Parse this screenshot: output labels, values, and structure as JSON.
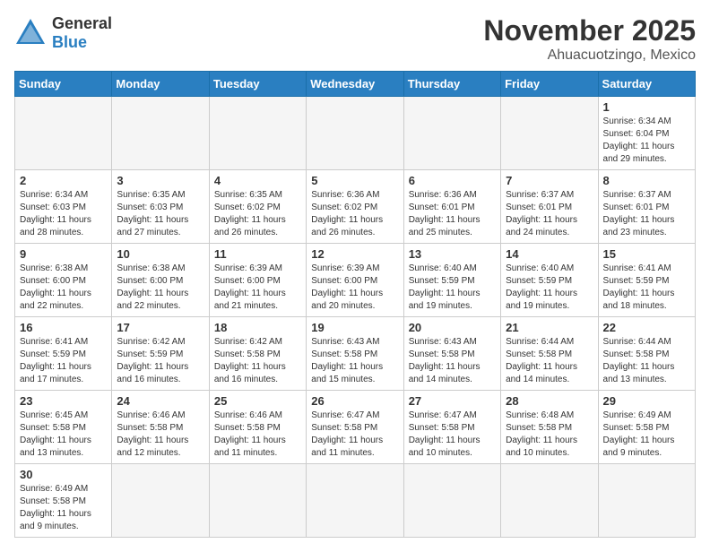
{
  "header": {
    "logo_general": "General",
    "logo_blue": "Blue",
    "month_year": "November 2025",
    "location": "Ahuacuotzingo, Mexico"
  },
  "days_of_week": [
    "Sunday",
    "Monday",
    "Tuesday",
    "Wednesday",
    "Thursday",
    "Friday",
    "Saturday"
  ],
  "weeks": [
    [
      {
        "day": "",
        "info": ""
      },
      {
        "day": "",
        "info": ""
      },
      {
        "day": "",
        "info": ""
      },
      {
        "day": "",
        "info": ""
      },
      {
        "day": "",
        "info": ""
      },
      {
        "day": "",
        "info": ""
      },
      {
        "day": "1",
        "info": "Sunrise: 6:34 AM\nSunset: 6:04 PM\nDaylight: 11 hours and 29 minutes."
      }
    ],
    [
      {
        "day": "2",
        "info": "Sunrise: 6:34 AM\nSunset: 6:03 PM\nDaylight: 11 hours and 28 minutes."
      },
      {
        "day": "3",
        "info": "Sunrise: 6:35 AM\nSunset: 6:03 PM\nDaylight: 11 hours and 27 minutes."
      },
      {
        "day": "4",
        "info": "Sunrise: 6:35 AM\nSunset: 6:02 PM\nDaylight: 11 hours and 26 minutes."
      },
      {
        "day": "5",
        "info": "Sunrise: 6:36 AM\nSunset: 6:02 PM\nDaylight: 11 hours and 26 minutes."
      },
      {
        "day": "6",
        "info": "Sunrise: 6:36 AM\nSunset: 6:01 PM\nDaylight: 11 hours and 25 minutes."
      },
      {
        "day": "7",
        "info": "Sunrise: 6:37 AM\nSunset: 6:01 PM\nDaylight: 11 hours and 24 minutes."
      },
      {
        "day": "8",
        "info": "Sunrise: 6:37 AM\nSunset: 6:01 PM\nDaylight: 11 hours and 23 minutes."
      }
    ],
    [
      {
        "day": "9",
        "info": "Sunrise: 6:38 AM\nSunset: 6:00 PM\nDaylight: 11 hours and 22 minutes."
      },
      {
        "day": "10",
        "info": "Sunrise: 6:38 AM\nSunset: 6:00 PM\nDaylight: 11 hours and 22 minutes."
      },
      {
        "day": "11",
        "info": "Sunrise: 6:39 AM\nSunset: 6:00 PM\nDaylight: 11 hours and 21 minutes."
      },
      {
        "day": "12",
        "info": "Sunrise: 6:39 AM\nSunset: 6:00 PM\nDaylight: 11 hours and 20 minutes."
      },
      {
        "day": "13",
        "info": "Sunrise: 6:40 AM\nSunset: 5:59 PM\nDaylight: 11 hours and 19 minutes."
      },
      {
        "day": "14",
        "info": "Sunrise: 6:40 AM\nSunset: 5:59 PM\nDaylight: 11 hours and 19 minutes."
      },
      {
        "day": "15",
        "info": "Sunrise: 6:41 AM\nSunset: 5:59 PM\nDaylight: 11 hours and 18 minutes."
      }
    ],
    [
      {
        "day": "16",
        "info": "Sunrise: 6:41 AM\nSunset: 5:59 PM\nDaylight: 11 hours and 17 minutes."
      },
      {
        "day": "17",
        "info": "Sunrise: 6:42 AM\nSunset: 5:59 PM\nDaylight: 11 hours and 16 minutes."
      },
      {
        "day": "18",
        "info": "Sunrise: 6:42 AM\nSunset: 5:58 PM\nDaylight: 11 hours and 16 minutes."
      },
      {
        "day": "19",
        "info": "Sunrise: 6:43 AM\nSunset: 5:58 PM\nDaylight: 11 hours and 15 minutes."
      },
      {
        "day": "20",
        "info": "Sunrise: 6:43 AM\nSunset: 5:58 PM\nDaylight: 11 hours and 14 minutes."
      },
      {
        "day": "21",
        "info": "Sunrise: 6:44 AM\nSunset: 5:58 PM\nDaylight: 11 hours and 14 minutes."
      },
      {
        "day": "22",
        "info": "Sunrise: 6:44 AM\nSunset: 5:58 PM\nDaylight: 11 hours and 13 minutes."
      }
    ],
    [
      {
        "day": "23",
        "info": "Sunrise: 6:45 AM\nSunset: 5:58 PM\nDaylight: 11 hours and 13 minutes."
      },
      {
        "day": "24",
        "info": "Sunrise: 6:46 AM\nSunset: 5:58 PM\nDaylight: 11 hours and 12 minutes."
      },
      {
        "day": "25",
        "info": "Sunrise: 6:46 AM\nSunset: 5:58 PM\nDaylight: 11 hours and 11 minutes."
      },
      {
        "day": "26",
        "info": "Sunrise: 6:47 AM\nSunset: 5:58 PM\nDaylight: 11 hours and 11 minutes."
      },
      {
        "day": "27",
        "info": "Sunrise: 6:47 AM\nSunset: 5:58 PM\nDaylight: 11 hours and 10 minutes."
      },
      {
        "day": "28",
        "info": "Sunrise: 6:48 AM\nSunset: 5:58 PM\nDaylight: 11 hours and 10 minutes."
      },
      {
        "day": "29",
        "info": "Sunrise: 6:49 AM\nSunset: 5:58 PM\nDaylight: 11 hours and 9 minutes."
      }
    ],
    [
      {
        "day": "30",
        "info": "Sunrise: 6:49 AM\nSunset: 5:58 PM\nDaylight: 11 hours and 9 minutes."
      },
      {
        "day": "",
        "info": ""
      },
      {
        "day": "",
        "info": ""
      },
      {
        "day": "",
        "info": ""
      },
      {
        "day": "",
        "info": ""
      },
      {
        "day": "",
        "info": ""
      },
      {
        "day": "",
        "info": ""
      }
    ]
  ]
}
